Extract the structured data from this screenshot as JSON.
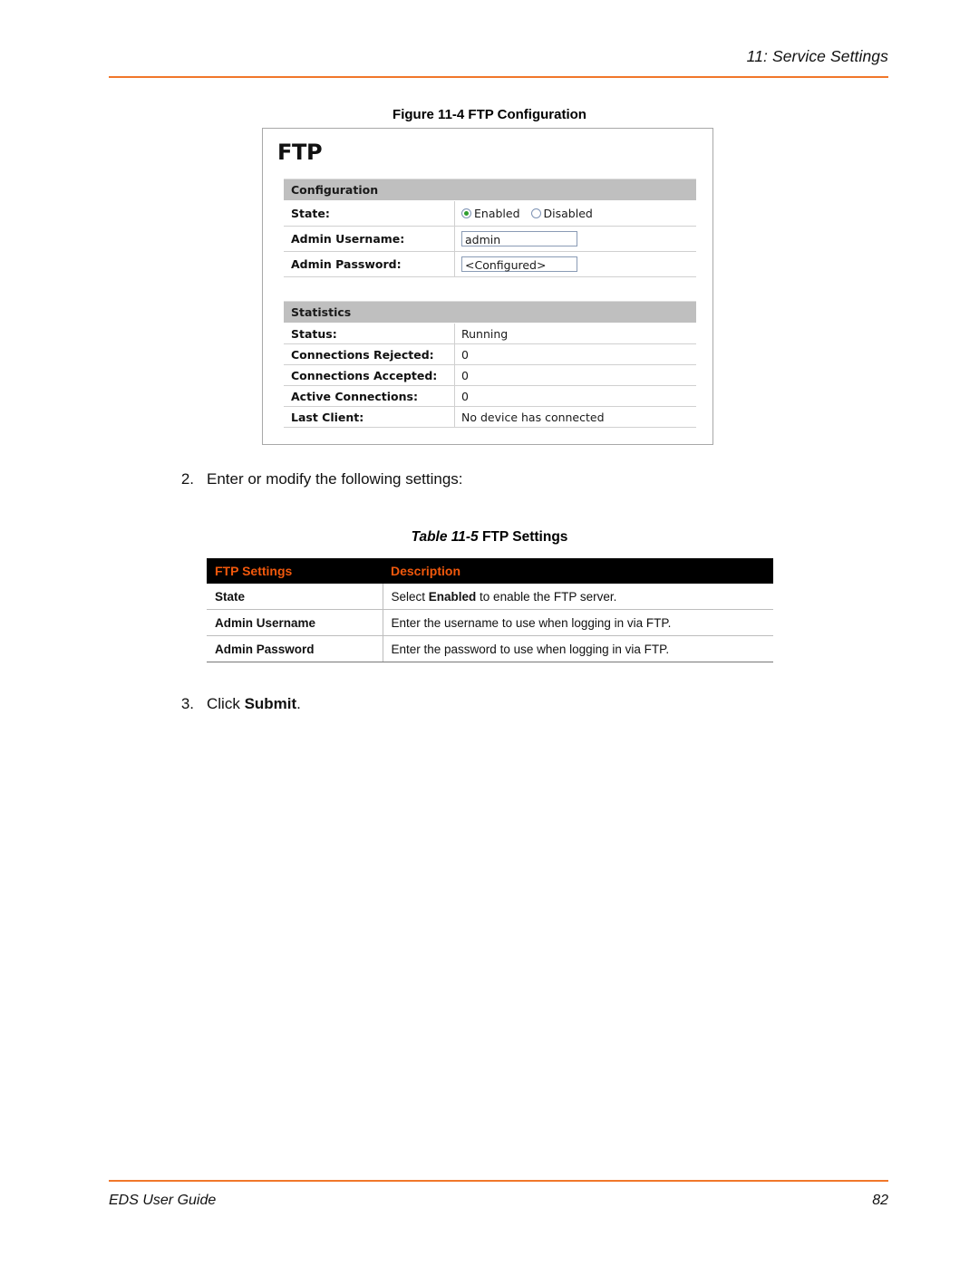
{
  "header": {
    "running_head": "11: Service Settings",
    "rule_color": "#F1772A"
  },
  "figure": {
    "caption": "Figure 11-4  FTP Configuration",
    "screenshot": {
      "title": "FTP",
      "configuration": {
        "section_label": "Configuration",
        "rows": [
          {
            "label": "State:",
            "type": "radio",
            "options": [
              {
                "label": "Enabled",
                "selected": true
              },
              {
                "label": "Disabled",
                "selected": false
              }
            ]
          },
          {
            "label": "Admin Username:",
            "type": "text",
            "value": "admin"
          },
          {
            "label": "Admin Password:",
            "type": "text",
            "value": "<Configured>"
          }
        ]
      },
      "statistics": {
        "section_label": "Statistics",
        "rows": [
          {
            "label": "Status:",
            "value": "Running"
          },
          {
            "label": "Connections Rejected:",
            "value": "0"
          },
          {
            "label": "Connections Accepted:",
            "value": "0"
          },
          {
            "label": "Active Connections:",
            "value": "0"
          },
          {
            "label": "Last Client:",
            "value": "No device has connected"
          }
        ]
      },
      "radio_selected_color": "#2F9E2F",
      "section_header_color": "#BFBFBF"
    }
  },
  "steps": [
    {
      "number": "2.",
      "text": "Enter or modify the following settings:"
    },
    {
      "number": "3.",
      "text_before": "Click ",
      "bold": "Submit",
      "text_after": "."
    }
  ],
  "table": {
    "caption_number": "Table 11-5",
    "caption_title": "FTP Settings",
    "header_bg": "#000000",
    "header_color": "#F1580C",
    "columns": [
      "FTP Settings",
      "Description"
    ],
    "rows": [
      {
        "setting": "State",
        "desc_before": "Select ",
        "desc_bold": "Enabled",
        "desc_after": " to enable the FTP server."
      },
      {
        "setting": "Admin Username",
        "desc_before": "Enter the username to use when logging in via FTP.",
        "desc_bold": "",
        "desc_after": ""
      },
      {
        "setting": "Admin Password",
        "desc_before": "Enter the password to use when logging in via FTP.",
        "desc_bold": "",
        "desc_after": ""
      }
    ]
  },
  "footer": {
    "left": "EDS User Guide",
    "page_number": "82",
    "rule_color": "#F1772A"
  }
}
